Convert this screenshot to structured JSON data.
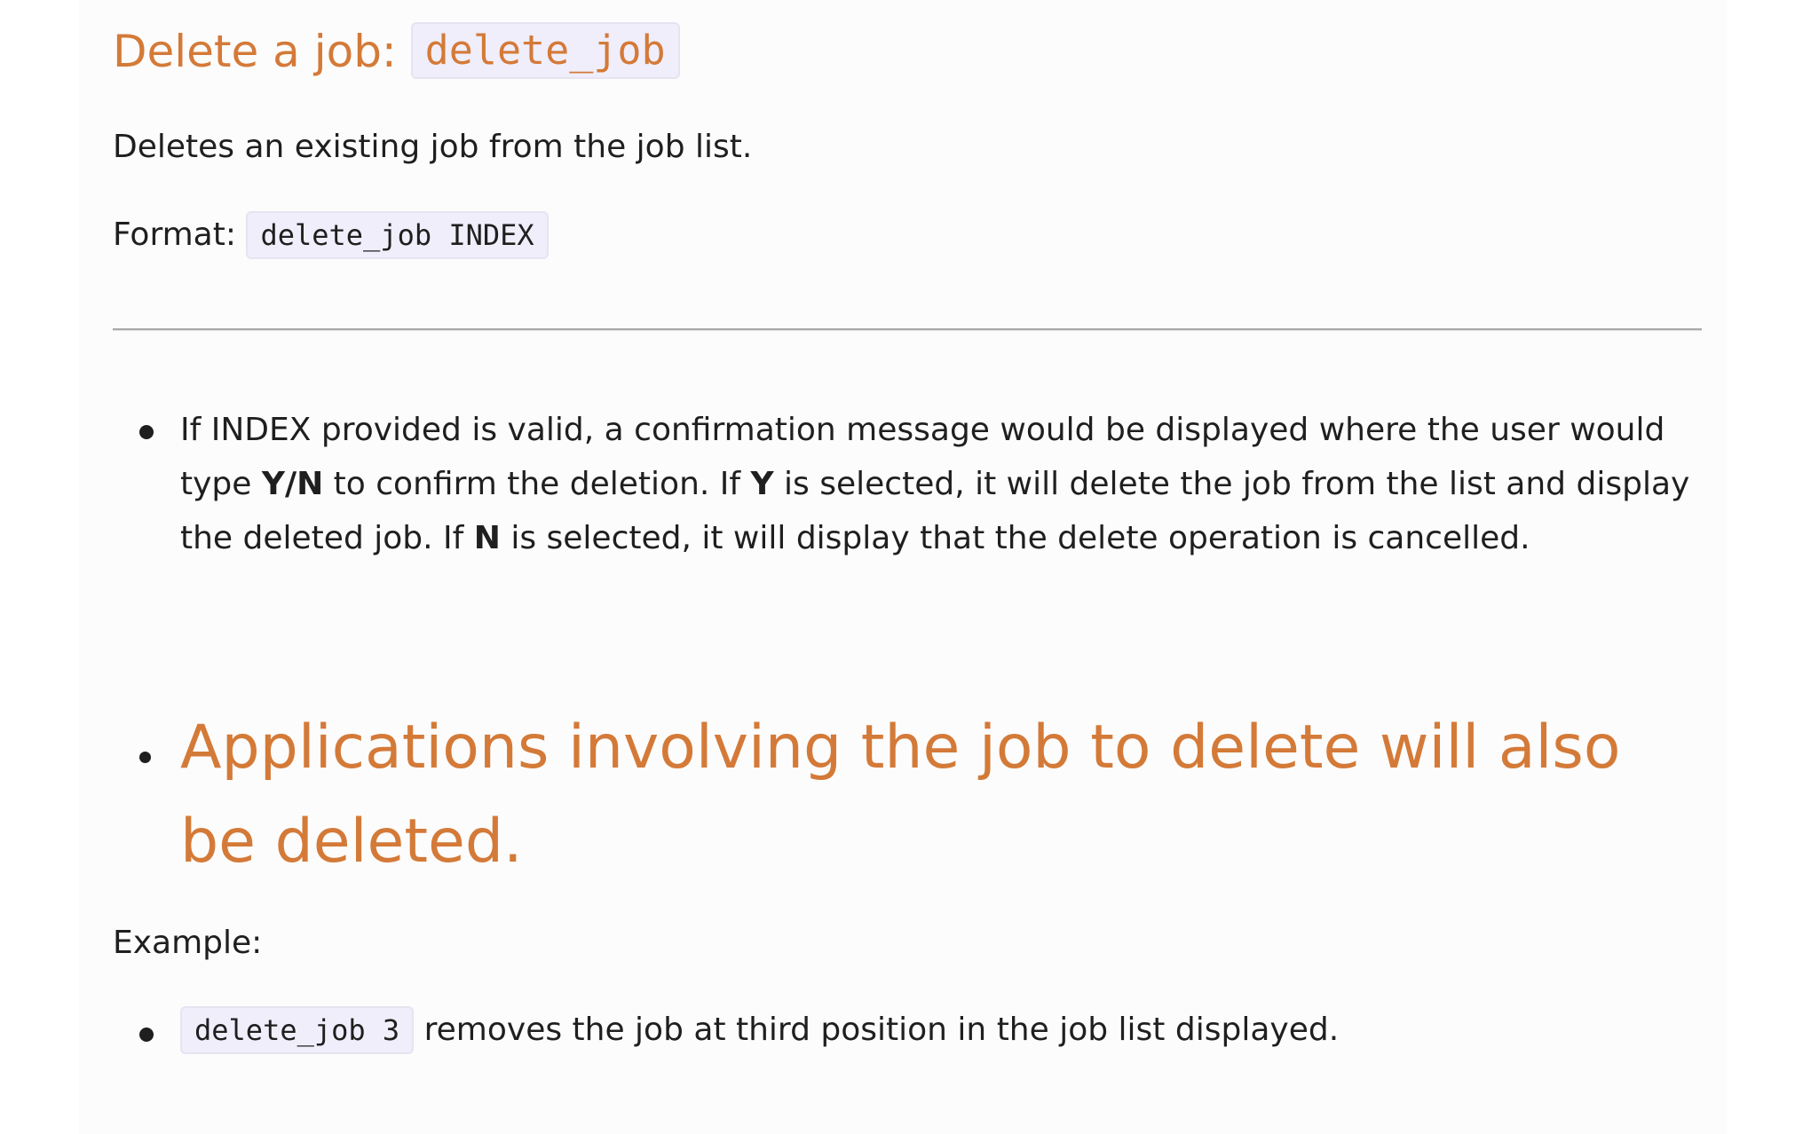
{
  "section": {
    "title_prefix": "Delete a job: ",
    "title_code": "delete_job"
  },
  "description": "Deletes an existing job from the job list.",
  "format": {
    "label": "Format: ",
    "code": "delete_job INDEX"
  },
  "notes": {
    "validity": {
      "part1": "If INDEX provided is valid, a confirmation message would be displayed where the user would type ",
      "yn": "Y/N",
      "part2": " to confirm the deletion. If ",
      "y": "Y",
      "part3": " is selected, it will delete the job from the list and display the deleted job. If ",
      "n": "N",
      "part4": " is selected, it will display that the delete operation is cancelled."
    },
    "applications": "Applications involving the job to delete will also be deleted."
  },
  "example": {
    "label": "Example:",
    "code": "delete_job 3",
    "text": " removes the job at third position in the job list displayed."
  }
}
